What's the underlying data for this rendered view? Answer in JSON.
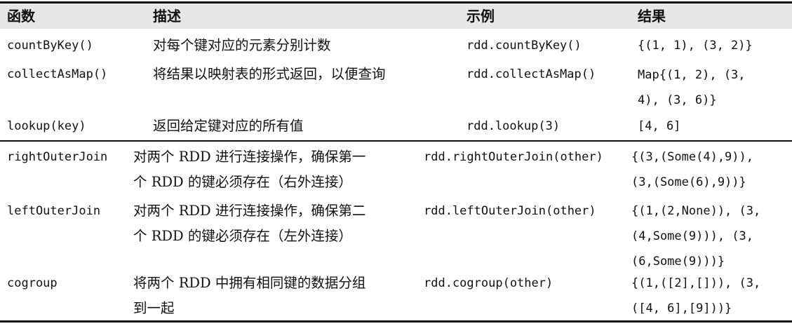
{
  "headers": {
    "function": "函数",
    "description": "描述",
    "example": "示例",
    "result": "结果"
  },
  "rows": [
    {
      "function": "countByKey()",
      "description": "对每个键对应的元素分别计数",
      "example": "rdd.countByKey()",
      "result": "{(1, 1), (3, 2)}"
    },
    {
      "function": "collectAsMap()",
      "description": "将结果以映射表的形式返回，以便查询",
      "example": "rdd.collectAsMap()",
      "result": "Map{(1, 2), (3,\n4), (3, 6)}"
    },
    {
      "function": "lookup(key)",
      "description": "返回给定键对应的所有值",
      "example": "rdd.lookup(3)",
      "result": "[4, 6]"
    },
    {
      "function": "rightOuterJoin",
      "description": "对两个 RDD 进行连接操作，确保第一\n个 RDD 的键必须存在（右外连接）",
      "example": "rdd.rightOuterJoin(other)",
      "result": "{(3,(Some(4),9)),\n(3,(Some(6),9))}"
    },
    {
      "function": "leftOuterJoin",
      "description": "对两个 RDD 进行连接操作，确保第二\n个 RDD 的键必须存在（左外连接）",
      "example": "rdd.leftOuterJoin(other)",
      "result": "{(1,(2,None)), (3,\n(4,Some(9))), (3,\n(6,Some(9)))}"
    },
    {
      "function": "cogroup",
      "description": "将两个 RDD 中拥有相同键的数据分组\n到一起",
      "example": "rdd.cogroup(other)",
      "result": "{(1,([2],[])), (3,\n([4, 6],[9]))}"
    }
  ]
}
